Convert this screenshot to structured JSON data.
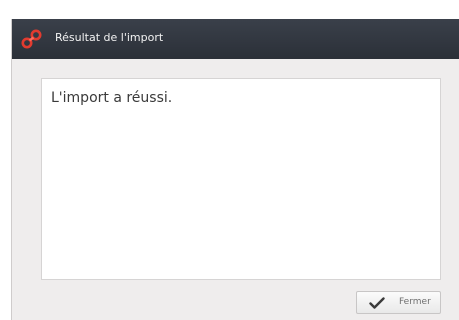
{
  "window": {
    "title": "Résultat de l'import",
    "icon": "link-chain-icon",
    "accent_color": "#e23b2f"
  },
  "message": {
    "text": "L'import a réussi."
  },
  "footer": {
    "close_label": "Fermer",
    "close_icon": "checkmark-icon"
  }
}
